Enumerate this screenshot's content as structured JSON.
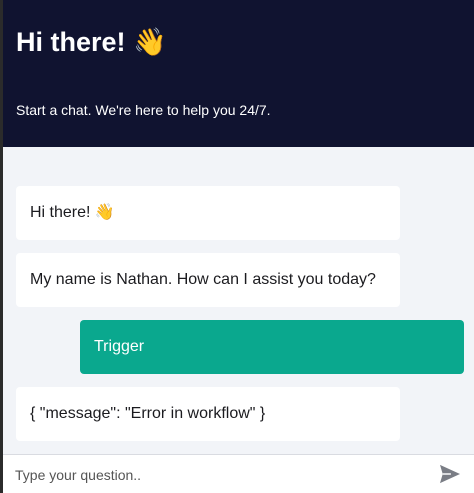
{
  "header": {
    "title": "Hi there! 👋",
    "subtitle": "Start a chat. We're here to help you 24/7."
  },
  "messages": [
    {
      "sender": "bot",
      "text": "Hi there! 👋"
    },
    {
      "sender": "bot",
      "text": "My name is Nathan. How can I assist you today?"
    },
    {
      "sender": "user",
      "text": "Trigger"
    },
    {
      "sender": "bot",
      "text": "{ \"message\": \"Error in workflow\" }"
    }
  ],
  "input": {
    "placeholder": "Type your question..",
    "value": ""
  },
  "colors": {
    "header_bg": "#101330",
    "user_bubble": "#0aa88e",
    "bot_bubble": "#ffffff"
  },
  "icons": {
    "send": "send-icon"
  }
}
